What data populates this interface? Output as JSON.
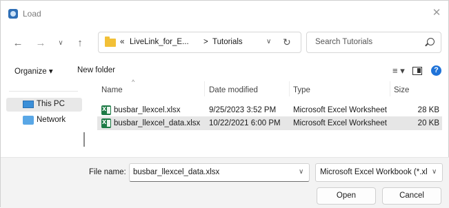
{
  "window": {
    "title": "Load"
  },
  "address": {
    "crumbs": [
      "«",
      "LiveLink_for_E...",
      ">",
      "Tutorials"
    ],
    "search_placeholder": "Search Tutorials"
  },
  "toolbar": {
    "organize": "Organize ▾",
    "new_folder": "New folder"
  },
  "nav": {
    "items": [
      {
        "label": "This PC",
        "selected": true
      },
      {
        "label": "Network",
        "selected": false
      }
    ]
  },
  "columns": [
    "Name",
    "Date modified",
    "Type",
    "Size"
  ],
  "files": [
    {
      "name": "busbar_llexcel.xlsx",
      "date": "9/25/2023 3:52 PM",
      "type": "Microsoft Excel Worksheet",
      "size": "28 KB",
      "selected": false
    },
    {
      "name": "busbar_llexcel_data.xlsx",
      "date": "10/22/2021 6:00 PM",
      "type": "Microsoft Excel Worksheet",
      "size": "20 KB",
      "selected": true
    }
  ],
  "footer": {
    "file_name_label": "File name:",
    "file_name_value": "busbar_llexcel_data.xlsx",
    "file_type": "Microsoft Excel Workbook (*.xl",
    "open_label": "Open",
    "cancel_label": "Cancel"
  },
  "colors": {
    "help_blue": "#1f73d8",
    "excel_green": "#1d7a45",
    "folder_yellow": "#f2c037",
    "selection": "#e6e6e6"
  }
}
